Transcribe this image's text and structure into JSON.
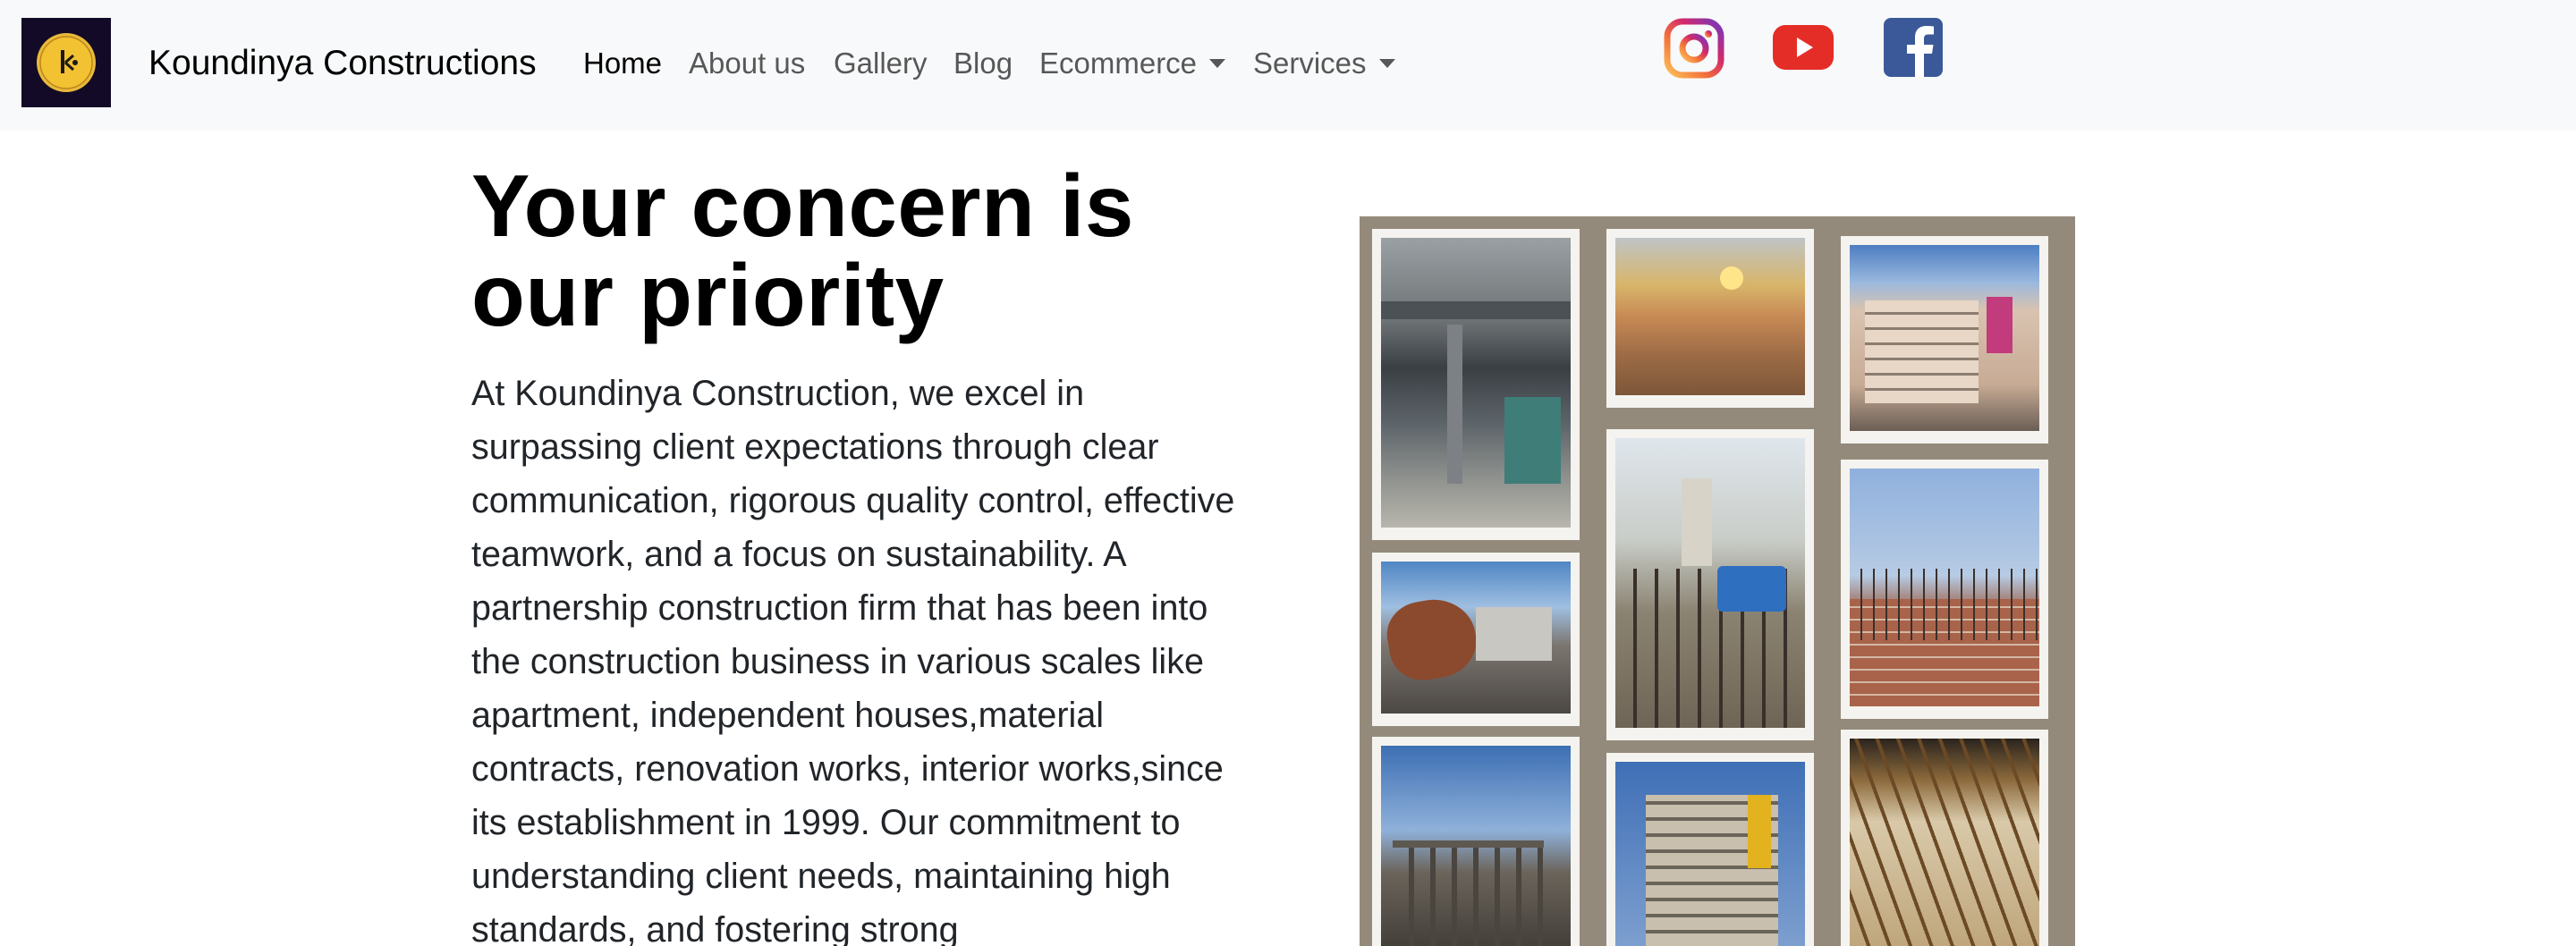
{
  "brand": {
    "name": "Koundinya Constructions",
    "logo_icon": "koundinya-k-logo-icon"
  },
  "nav": {
    "items": [
      {
        "label": "Home",
        "active": true,
        "dropdown": false
      },
      {
        "label": "About us",
        "active": false,
        "dropdown": false
      },
      {
        "label": "Gallery",
        "active": false,
        "dropdown": false
      },
      {
        "label": "Blog",
        "active": false,
        "dropdown": false
      },
      {
        "label": "Ecommerce",
        "active": false,
        "dropdown": true
      },
      {
        "label": "Services",
        "active": false,
        "dropdown": true
      }
    ]
  },
  "social": [
    {
      "name": "instagram-icon"
    },
    {
      "name": "youtube-icon"
    },
    {
      "name": "facebook-icon"
    }
  ],
  "hero": {
    "title": "Your concern is our priority",
    "body": "At Koundinya Construction, we excel in surpassing client expectations through clear communication, rigorous quality control, effective teamwork, and a focus on sustainability. A partnership construction firm that has been into the construction business in various scales like apartment, independent houses,material contracts, renovation works, interior works,since its establishment in 1999. Our commitment to understanding client needs, maintaining high standards, and fostering strong"
  },
  "colors": {
    "navbar_bg": "#f8f9fa",
    "collage_bg": "#948a7b",
    "youtube_red": "#e52d27",
    "facebook_blue": "#3b5998"
  },
  "gallery": {
    "photos": [
      "construction-parking-photo",
      "site-sunset-photo",
      "building-facade-photo",
      "worker-with-bucket-photo",
      "concrete-mixer-photo",
      "rebar-brick-wall-photo",
      "building-frame-photo",
      "apartment-scaffolding-photo",
      "formwork-props-photo"
    ]
  }
}
